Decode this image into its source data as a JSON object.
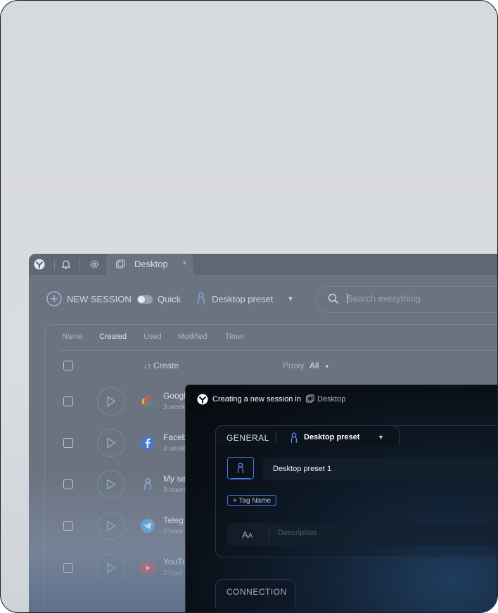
{
  "app": {
    "tab": {
      "label": "Desktop"
    },
    "toolbar": {
      "new_session": "NEW SESSION",
      "quick": "Quick",
      "preset": "Desktop preset",
      "search_placeholder": "Search everything"
    },
    "columns": [
      "Name",
      "Created",
      "Used",
      "Modified",
      "Timer"
    ],
    "active_column": "Created",
    "header": {
      "sort": "Create",
      "proxy_label": "Proxy",
      "proxy_value": "All"
    },
    "rows": [
      {
        "name": "Googl",
        "sub": "3 week",
        "icon": "google-icon"
      },
      {
        "name": "Faceb",
        "sub": "3 week",
        "icon": "facebook-icon"
      },
      {
        "name": "My se",
        "sub": "3 hours",
        "icon": "person-icon"
      },
      {
        "name": "Teleg",
        "sub": "2 hour",
        "icon": "telegram-icon"
      },
      {
        "name": "YouTu",
        "sub": "2 hour",
        "icon": "youtube-icon"
      }
    ]
  },
  "dialog": {
    "title": "Creating a new session in",
    "workspace": "Desktop",
    "general_tab": "GENERAL",
    "preset": "Desktop preset",
    "name_value": "Desktop preset 1",
    "tag_button": "+ Tag Name",
    "description_placeholder": "Description",
    "connection_tab": "CONNECTION"
  },
  "colors": {
    "accent": "#3f7ce6",
    "background_app": "#6b7381",
    "dialog_bg": "#0a1018"
  }
}
